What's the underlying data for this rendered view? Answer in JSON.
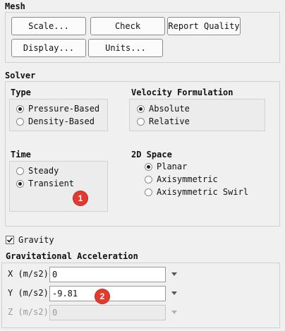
{
  "mesh": {
    "title": "Mesh",
    "buttons": {
      "scale": "Scale...",
      "check": "Check",
      "report_quality": "Report Quality",
      "display": "Display...",
      "units": "Units..."
    }
  },
  "solver": {
    "title": "Solver",
    "type": {
      "title": "Type",
      "options": [
        "Pressure-Based",
        "Density-Based"
      ],
      "selected": "Pressure-Based"
    },
    "velocity_formulation": {
      "title": "Velocity Formulation",
      "options": [
        "Absolute",
        "Relative"
      ],
      "selected": "Absolute"
    },
    "time": {
      "title": "Time",
      "options": [
        "Steady",
        "Transient"
      ],
      "selected": "Transient"
    },
    "space_2d": {
      "title": "2D Space",
      "options": [
        "Planar",
        "Axisymmetric",
        "Axisymmetric Swirl"
      ],
      "selected": "Planar"
    }
  },
  "gravity": {
    "label": "Gravity",
    "checked": true
  },
  "gravitational_acceleration": {
    "title": "Gravitational Acceleration",
    "x": {
      "label": "X (m/s2)",
      "value": "0"
    },
    "y": {
      "label": "Y (m/s2)",
      "value": "-9.81"
    },
    "z": {
      "label": "Z (m/s2)",
      "value": "0",
      "disabled": true
    }
  },
  "annotations": {
    "one": "1",
    "two": "2"
  },
  "colors": {
    "badge": "#e23a2e",
    "background": "#f0f0f0"
  }
}
